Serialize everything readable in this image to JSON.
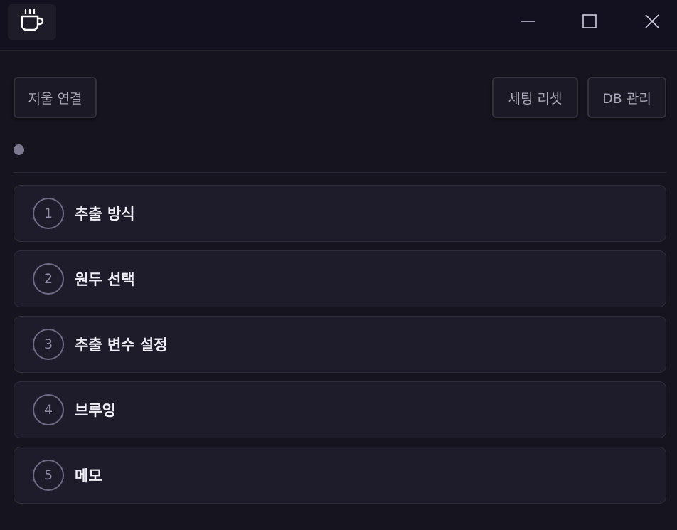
{
  "titlebar": {
    "app_icon": "coffee-cup-icon",
    "controls": [
      "minimize-icon",
      "maximize-icon",
      "close-icon"
    ]
  },
  "toolbar": {
    "connect_label": "저울 연결",
    "reset_label": "세팅 리셋",
    "db_label": "DB 관리"
  },
  "status": {
    "dot_color": "#7b7890"
  },
  "steps": [
    {
      "number": "1",
      "label": "추출 방식"
    },
    {
      "number": "2",
      "label": "원두 선택"
    },
    {
      "number": "3",
      "label": "추출 변수 설정"
    },
    {
      "number": "4",
      "label": "브루잉"
    },
    {
      "number": "5",
      "label": "메모"
    }
  ],
  "colors": {
    "background": "#16141f",
    "card": "#1e1b2b",
    "text": "#f0eef7",
    "muted": "#a9a6b8"
  }
}
